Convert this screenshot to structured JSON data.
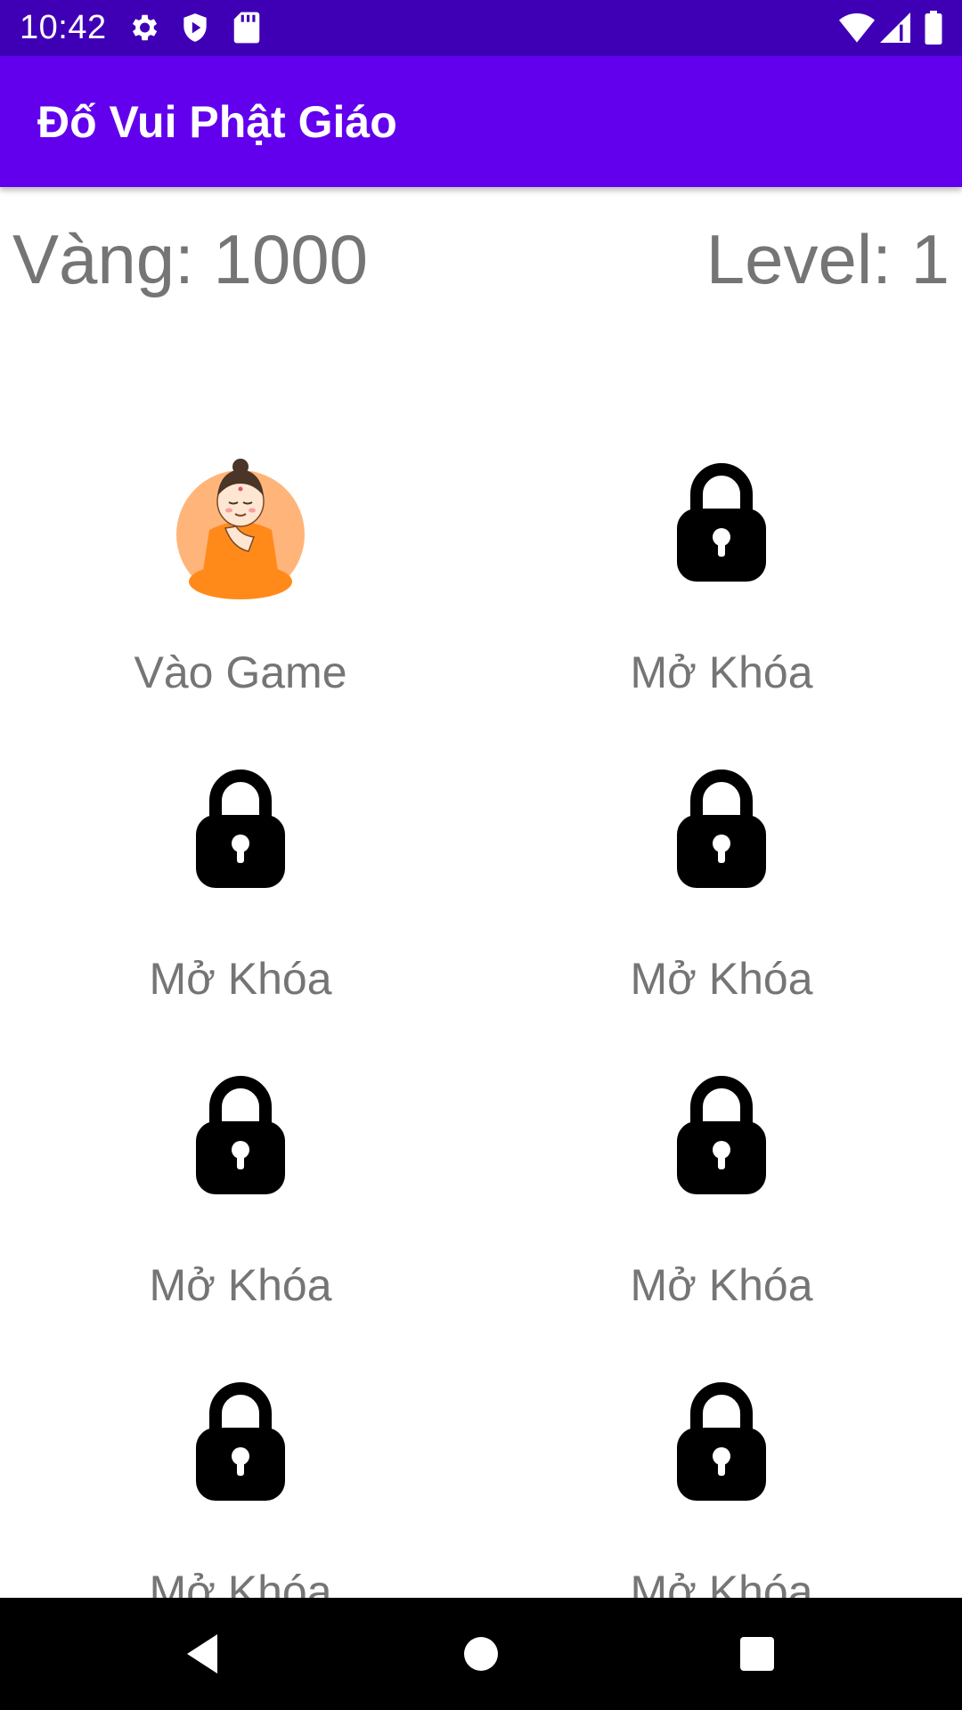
{
  "status_bar": {
    "time": "10:42",
    "icons_left": [
      "gear-icon",
      "shield-icon",
      "sd-card-icon"
    ],
    "icons_right": [
      "wifi-icon",
      "signal-icon",
      "battery-icon"
    ]
  },
  "app_bar": {
    "title": "Đố Vui Phật Giáo",
    "color": "#6200ee"
  },
  "stats": {
    "gold": "Vàng: 1000",
    "level": "Level: 1"
  },
  "levels": [
    {
      "label": "Vào Game",
      "icon": "buddha-icon",
      "unlocked": true
    },
    {
      "label": "Mở Khóa",
      "icon": "lock-icon",
      "unlocked": false
    },
    {
      "label": "Mở Khóa",
      "icon": "lock-icon",
      "unlocked": false
    },
    {
      "label": "Mở Khóa",
      "icon": "lock-icon",
      "unlocked": false
    },
    {
      "label": "Mở Khóa",
      "icon": "lock-icon",
      "unlocked": false
    },
    {
      "label": "Mở Khóa",
      "icon": "lock-icon",
      "unlocked": false
    },
    {
      "label": "Mở Khóa",
      "icon": "lock-icon",
      "unlocked": false
    },
    {
      "label": "Mở Khóa",
      "icon": "lock-icon",
      "unlocked": false
    }
  ],
  "nav_bar": {
    "buttons": [
      "back-icon",
      "home-icon",
      "recents-icon"
    ]
  }
}
